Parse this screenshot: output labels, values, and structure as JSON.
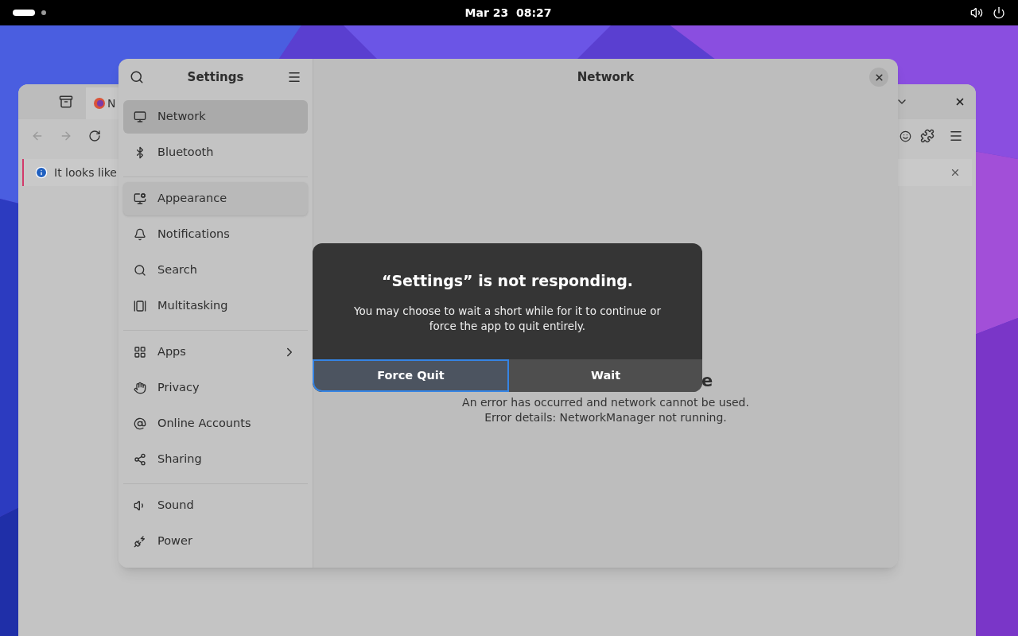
{
  "top_bar": {
    "clock": "Mar 23  08:27"
  },
  "browser_window": {
    "tab_label": "N",
    "info_text": "It looks like"
  },
  "settings": {
    "title": "Settings",
    "page_title": "Network",
    "sidebar": [
      [
        {
          "label": "Network",
          "selected": true,
          "hovered": false,
          "expandable": false
        },
        {
          "label": "Bluetooth",
          "selected": false,
          "hovered": false,
          "expandable": false
        }
      ],
      [
        {
          "label": "Appearance",
          "selected": false,
          "hovered": true,
          "expandable": false
        },
        {
          "label": "Notifications",
          "selected": false,
          "hovered": false,
          "expandable": false
        },
        {
          "label": "Search",
          "selected": false,
          "hovered": false,
          "expandable": false
        },
        {
          "label": "Multitasking",
          "selected": false,
          "hovered": false,
          "expandable": false
        }
      ],
      [
        {
          "label": "Apps",
          "selected": false,
          "hovered": false,
          "expandable": true
        },
        {
          "label": "Privacy",
          "selected": false,
          "hovered": false,
          "expandable": false
        },
        {
          "label": "Online Accounts",
          "selected": false,
          "hovered": false,
          "expandable": false
        },
        {
          "label": "Sharing",
          "selected": false,
          "hovered": false,
          "expandable": false
        }
      ],
      [
        {
          "label": "Sound",
          "selected": false,
          "hovered": false,
          "expandable": false
        },
        {
          "label": "Power",
          "selected": false,
          "hovered": false,
          "expandable": false
        }
      ]
    ],
    "heading_fragment": "e",
    "message_lines": [
      "An error has occurred and network cannot be used.",
      "Error details: NetworkManager not running."
    ]
  },
  "dialog": {
    "title": "“Settings” is not responding.",
    "body": "You may choose to wait a short while for it to continue or force the app to quit entirely.",
    "buttons": [
      {
        "label": "Force Quit",
        "focused": true
      },
      {
        "label": "Wait",
        "focused": false
      }
    ]
  }
}
